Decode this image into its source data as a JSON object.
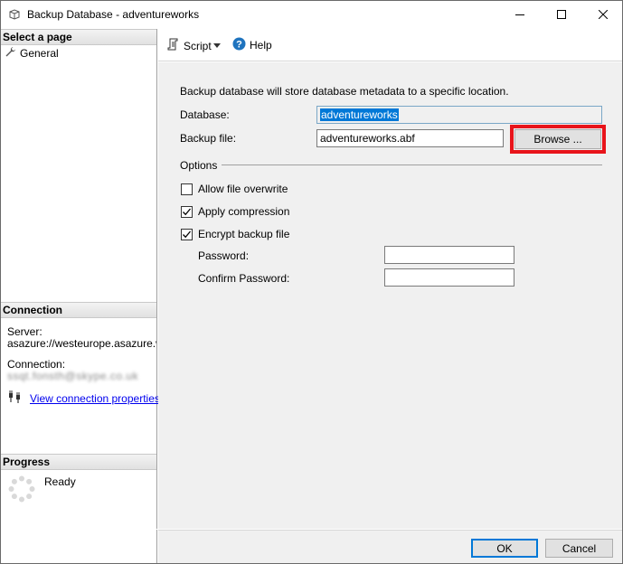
{
  "window": {
    "title": "Backup Database - adventureworks"
  },
  "left_pane": {
    "select_page_header": "Select a page",
    "pages": [
      {
        "label": "General",
        "icon": "wrench-icon"
      }
    ],
    "connection_header": "Connection",
    "server_label": "Server:",
    "server_value": "asazure://westeurope.asazure.windows.net",
    "connection_label": "Connection:",
    "connection_value_blurred": "ssqt.fonsth@skype.co.uk",
    "view_connection_link": "View connection properties",
    "progress_header": "Progress",
    "progress_status": "Ready"
  },
  "toolbar": {
    "script_label": "Script",
    "help_label": "Help"
  },
  "form": {
    "description": "Backup database will store database metadata to a specific location.",
    "database_label": "Database:",
    "database_value": "adventureworks",
    "backup_file_label": "Backup file:",
    "backup_file_value": "adventureworks.abf",
    "browse_label": "Browse ...",
    "options_label": "Options",
    "allow_overwrite_label": "Allow file overwrite",
    "allow_overwrite_checked": false,
    "apply_compression_label": "Apply compression",
    "apply_compression_checked": true,
    "encrypt_label": "Encrypt backup file",
    "encrypt_checked": true,
    "password_label": "Password:",
    "password_value": "",
    "confirm_password_label": "Confirm Password:",
    "confirm_password_value": ""
  },
  "footer": {
    "ok_label": "OK",
    "cancel_label": "Cancel"
  },
  "colors": {
    "highlight": "#e8141b",
    "selection": "#0078d7",
    "link": "#0000ee",
    "help_icon": "#1e73be"
  }
}
